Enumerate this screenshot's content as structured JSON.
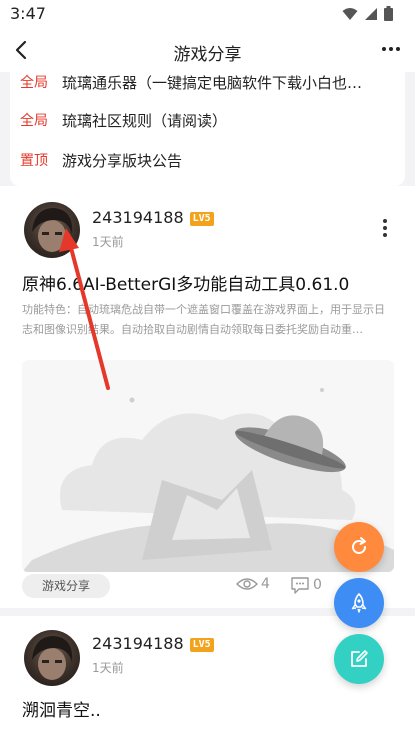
{
  "status_bar": {
    "time": "3:47"
  },
  "header": {
    "title": "游戏分享"
  },
  "notices": [
    {
      "tag": "全局",
      "text": "琉璃通乐器（一键搞定电脑软件下载小白也…"
    },
    {
      "tag": "全局",
      "text": "琉璃社区规则（请阅读）"
    },
    {
      "tag": "置顶",
      "text": "游戏分享版块公告"
    }
  ],
  "posts": [
    {
      "author": "243194188",
      "level": "LV5",
      "time_ago": "1天前",
      "title": "原神6.6AI-BetterGI多功能自动工具0.61.0",
      "excerpt": "功能特色：自动琉璃危战自带一个遮盖窗口覆盖在游戏界面上，用于显示日志和图像识别结果。自动拾取自动剧情自动领取每日委托奖励自动重…",
      "tag": "游戏分享",
      "views": "4",
      "comments": "0"
    },
    {
      "author": "243194188",
      "level": "LV5",
      "time_ago": "1天前",
      "title": "溯洄青空.."
    }
  ],
  "colors": {
    "accent_red": "#e5382b",
    "level_badge": "#f2a21b",
    "fab_refresh": "#ff8a3d",
    "fab_rocket": "#3d8df5",
    "fab_edit": "#33d1c4"
  }
}
